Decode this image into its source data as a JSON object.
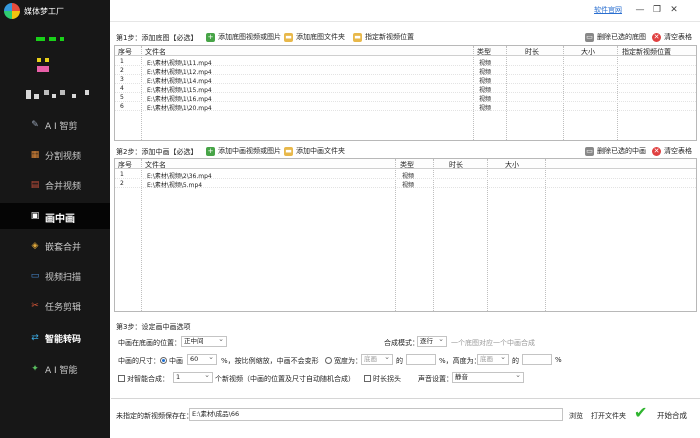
{
  "app": {
    "title": "媒体梦工厂",
    "link": "软件官网",
    "min": "—",
    "restore": "❐",
    "close": "✕"
  },
  "sidebar": {
    "items": [
      {
        "label": "A I 智剪",
        "icon": "ai-icon",
        "glyph": "✎"
      },
      {
        "label": "分割视频",
        "icon": "split-icon",
        "glyph": "▦"
      },
      {
        "label": "合并视频",
        "icon": "merge-icon",
        "glyph": "▤"
      },
      {
        "label": "画中画",
        "icon": "pip-icon",
        "glyph": "▣"
      },
      {
        "label": "嵌套合并",
        "icon": "nest-icon",
        "glyph": "◈"
      },
      {
        "label": "视频扫描",
        "icon": "scan-icon",
        "glyph": "▭"
      },
      {
        "label": "任务剪辑",
        "icon": "task-icon",
        "glyph": "✂"
      },
      {
        "label": "智能转码",
        "icon": "transcode-icon",
        "glyph": "⇄"
      },
      {
        "label": "A I 智能",
        "icon": "ai-smart-icon",
        "glyph": "✦"
      }
    ]
  },
  "step1": {
    "label": "第1步：添加底图【必选】",
    "add_files": "添加底图视频或图片",
    "add_folder": "添加底图文件夹",
    "locate": "指定新视频位置",
    "remove_selected": "删除已选的底图",
    "clear": "清空表格",
    "columns": [
      "序号",
      "文件名",
      "类型",
      "时长",
      "大小",
      "指定新视频位置"
    ],
    "rows": [
      {
        "no": "1",
        "name": "E:\\素材\\视频\\1\\11.mp4",
        "type": "视频"
      },
      {
        "no": "2",
        "name": "E:\\素材\\视频\\1\\12.mp4",
        "type": "视频"
      },
      {
        "no": "3",
        "name": "E:\\素材\\视频\\1\\14.mp4",
        "type": "视频"
      },
      {
        "no": "4",
        "name": "E:\\素材\\视频\\1\\15.mp4",
        "type": "视频"
      },
      {
        "no": "5",
        "name": "E:\\素材\\视频\\1\\16.mp4",
        "type": "视频"
      },
      {
        "no": "6",
        "name": "E:\\素材\\视频\\1\\20.mp4",
        "type": "视频"
      }
    ]
  },
  "step2": {
    "label": "第2步：添加中画【必选】",
    "add_files": "添加中画视频或图片",
    "add_folder": "添加中画文件夹",
    "remove_selected": "删除已选的中画",
    "clear": "清空表格",
    "columns": [
      "序号",
      "文件名",
      "类型",
      "时长",
      "大小"
    ],
    "rows": [
      {
        "no": "1",
        "name": "E:\\素材\\视频\\2\\36.mp4",
        "type": "视频"
      },
      {
        "no": "2",
        "name": "E:\\素材\\视频\\5.mp4",
        "type": "视频"
      }
    ]
  },
  "step3": {
    "label": "第3步：设定画中画选项",
    "position_label": "中画在底画的位置：",
    "position_value": "正中间",
    "mode_label": "合成模式：",
    "mode_value": "逐行",
    "mode_hint": "一个底图对应一个中画合成",
    "size_label": "中画的尺寸：",
    "size_option": "中画",
    "size_value": "60",
    "size_hint": "%，按比例缩放，中画不会变形",
    "width_option": "宽度为：",
    "width_placeholder": "底画",
    "width_of": "的",
    "width_pct": "%，高度为：",
    "height_placeholder": "底画",
    "height_of": "的",
    "height_pct": "%",
    "border_label": "对智能合成：",
    "border_value": "1",
    "border_hint": "个新视频（中画的位置及尺寸自动随机合成）",
    "duration_label": "时长拐头",
    "audio_label": "声音设置：",
    "audio_value": "静音"
  },
  "save": {
    "label": "未指定的新视频保存在：",
    "path": "E:\\素材\\成品\\66",
    "browse": "浏览",
    "open_folder": "打开文件夹",
    "start": "开始合成"
  }
}
